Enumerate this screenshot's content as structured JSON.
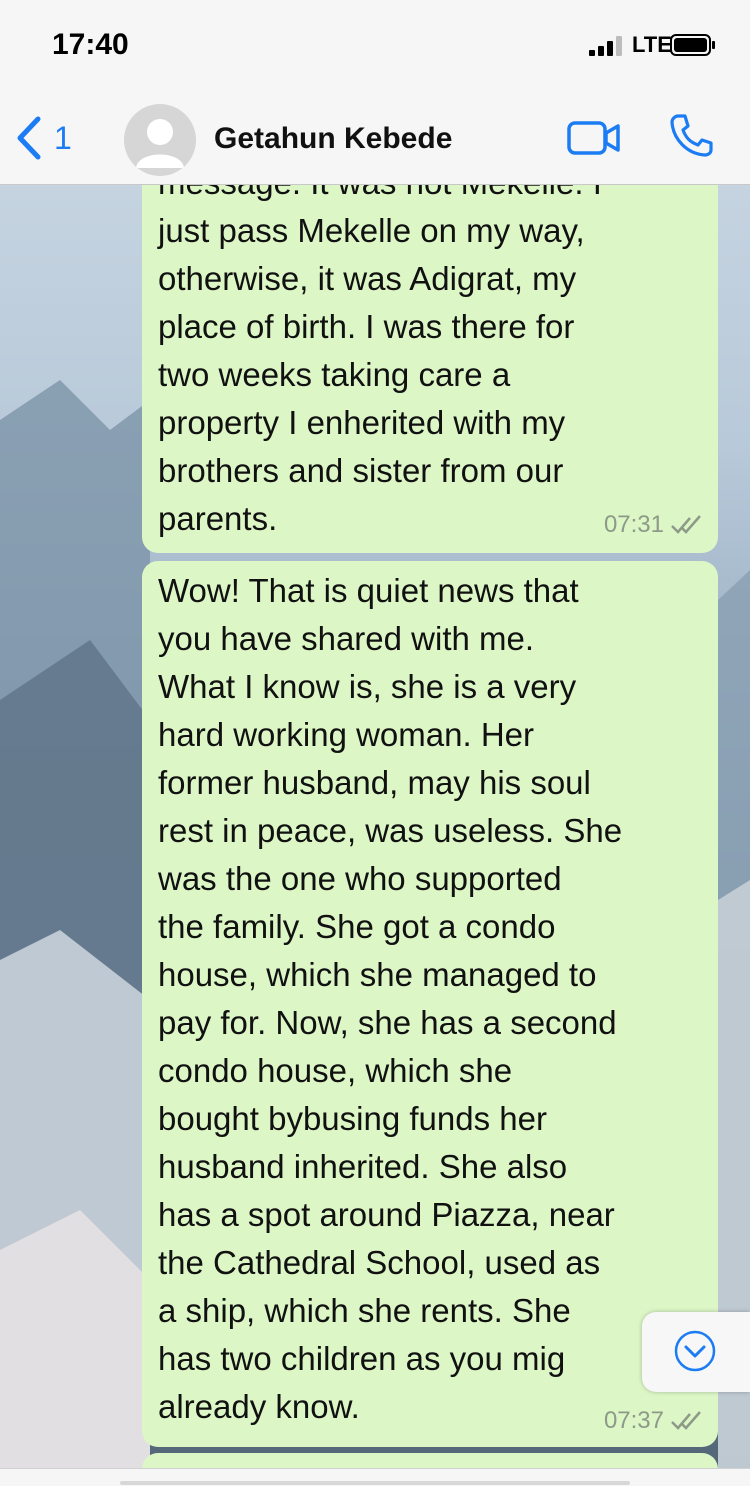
{
  "status_bar": {
    "time": "17:40",
    "network": "LTE",
    "icons": [
      "signal-icon",
      "battery-icon"
    ]
  },
  "header": {
    "back_count": "1",
    "contact_name": "Getahun Kebede",
    "icons": [
      "back-chevron-icon",
      "avatar-placeholder-icon",
      "video-camera-icon",
      "phone-icon"
    ],
    "accent_color": "#1b7cf4"
  },
  "messages": [
    {
      "text": "message. It was not Mekelle. I\njust pass Mekelle on my way,\notherwise, it was Adigrat, my\nplace of birth. I was there for\ntwo weeks taking care a\nproperty I enherited with my\nbrothers and sister from our\nparents.",
      "time": "07:31",
      "status": "read-double-check"
    },
    {
      "text": "Wow! That is quiet news that\nyou have shared with me.\nWhat I know is, she is a very\nhard working woman. Her\nformer husband, may his soul\nrest in peace, was useless. She\nwas the one who supported\nthe family. She got a condo\nhouse, which she managed to\npay for. Now, she has a second\ncondo house, which she\nbought bybusing funds her\nhusband inherited. She also\nhas a spot around Piazza, near\nthe Cathedral School, used as\na ship, which she rents. She\nhas two children as you mig\nalready know.",
      "time": "07:37",
      "status": "read-double-check"
    }
  ],
  "bubble_color": "#dcf6c6",
  "scroll_button_icon": "chevron-down-circle-icon"
}
